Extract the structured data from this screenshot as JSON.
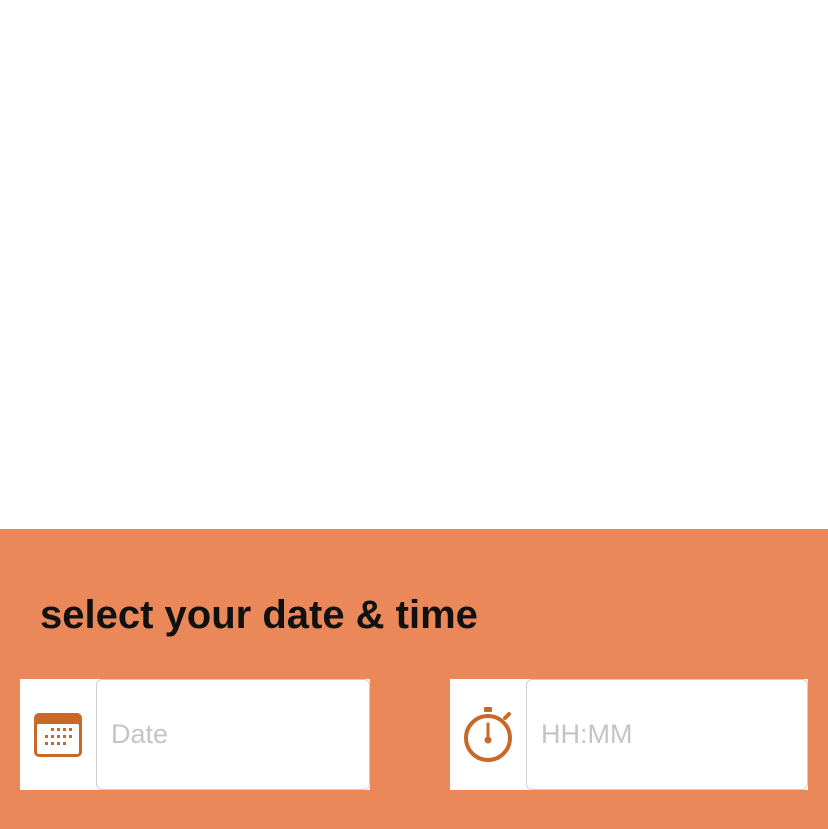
{
  "colors": {
    "panel_background": "#EB8859",
    "icon_accent": "#C8692A",
    "field_border": "#cfcfcf",
    "placeholder": "#c4c4c4"
  },
  "panel": {
    "heading": "select your date & time"
  },
  "date_field": {
    "icon": "calendar-icon",
    "placeholder": "Date",
    "value": ""
  },
  "time_field": {
    "icon": "stopwatch-icon",
    "placeholder": "HH:MM",
    "value": ""
  }
}
